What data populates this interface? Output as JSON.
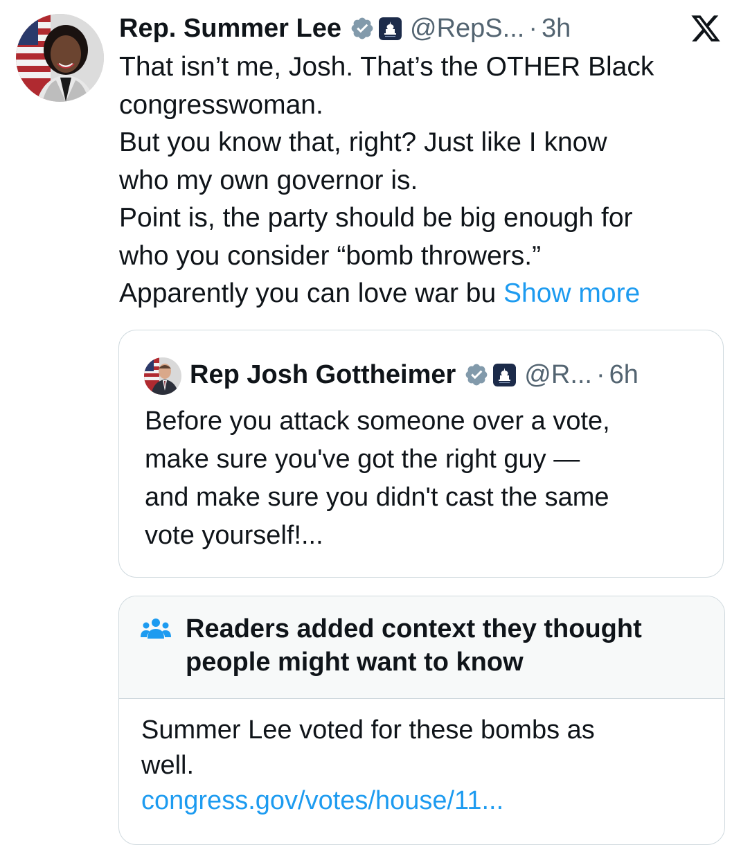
{
  "tweet": {
    "author_name": "Rep. Summer Lee",
    "handle": "@RepS...",
    "separator": "·",
    "time": "3h",
    "body_lines": [
      "That isn’t me, Josh. That’s the OTHER Black",
      "congresswoman.",
      "But you know that, right? Just like I know",
      "who my own governor is.",
      "Point is, the party should be big enough for",
      "who you consider “bomb throwers.”",
      "Apparently you can love war bu"
    ],
    "show_more": "Show more"
  },
  "quote": {
    "author_name": "Rep Josh Gottheimer",
    "handle": "@R...",
    "separator": "·",
    "time": "6h",
    "body_lines": [
      "Before you attack someone over a vote,",
      "make sure you've got the right guy —",
      "and make sure you didn't cast the same",
      "vote yourself!..."
    ]
  },
  "community_note": {
    "title_lines": [
      "Readers added context they thought",
      "people might want to know"
    ],
    "body_lines": [
      "Summer Lee voted for these bombs as",
      "well."
    ],
    "link": "congress.gov/votes/house/11..."
  },
  "icons": {
    "verified": "verified-badge-icon",
    "government": "capitol-badge-icon",
    "platform": "x-logo-icon",
    "readers": "people-group-icon"
  },
  "colors": {
    "text": "#0f1419",
    "secondary": "#536471",
    "link": "#1d9bf0",
    "border": "#cfd9de",
    "note_header_bg": "#f7f9f9"
  }
}
